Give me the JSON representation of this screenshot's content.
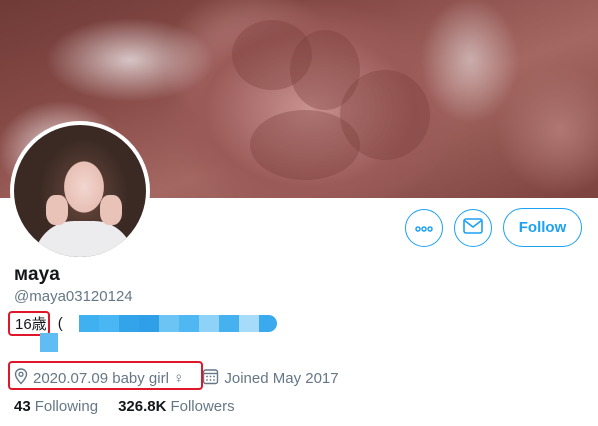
{
  "profile": {
    "display_name": "мaya",
    "handle": "@maya03120124",
    "bio": {
      "age_text": "16歳",
      "paren": "("
    },
    "location": "2020.07.09  baby girl ♀",
    "joined": "Joined May 2017",
    "stats": {
      "following_count": "43",
      "following_label": "Following",
      "followers_count": "326.8K",
      "followers_label": "Followers"
    }
  },
  "actions": {
    "more_icon": "ellipsis-icon",
    "message_icon": "envelope-icon",
    "follow_label": "Follow"
  },
  "colors": {
    "accent": "#1da1f2",
    "annotation_red": "#e0162b",
    "secondary_text": "#657786",
    "mosaic_blue": "#35a8ec"
  }
}
